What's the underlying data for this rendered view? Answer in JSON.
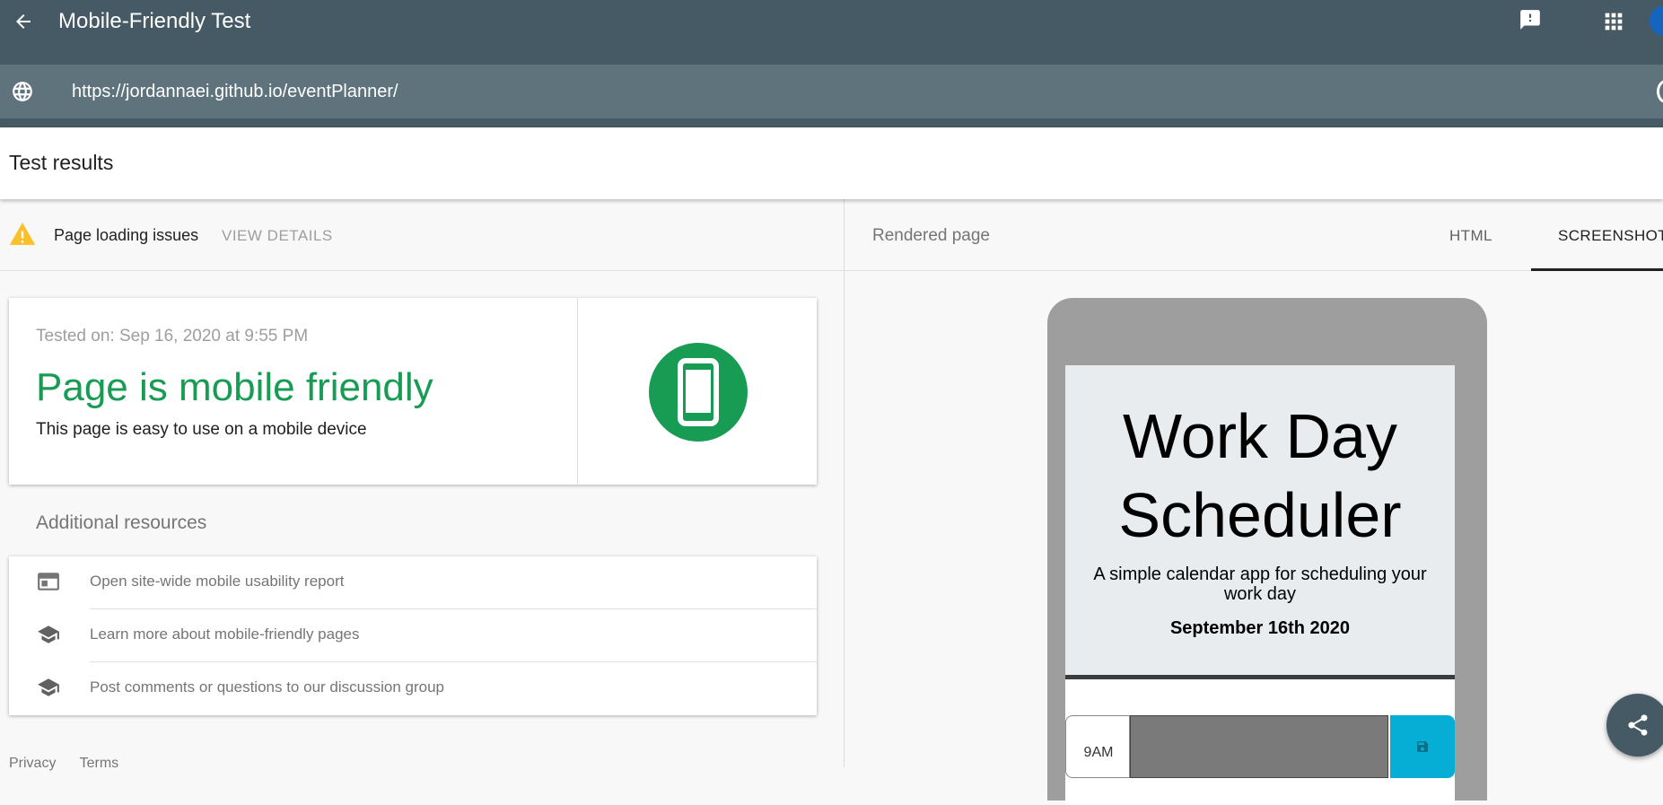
{
  "header": {
    "app_title": "Mobile-Friendly Test",
    "url_value": "https://jordannaei.github.io/eventPlanner/"
  },
  "results": {
    "title": "Test results",
    "issues_text": "Page loading issues",
    "view_details": "VIEW DETAILS"
  },
  "summary_card": {
    "tested_on": "Tested on: Sep 16, 2020 at 9:55 PM",
    "verdict": "Page is mobile friendly",
    "description": "This page is easy to use on a mobile device"
  },
  "resources": {
    "heading": "Additional resources",
    "items": [
      {
        "label": "Open site-wide mobile usability report",
        "icon": "report-icon"
      },
      {
        "label": "Learn more about mobile-friendly pages",
        "icon": "school-icon"
      },
      {
        "label": "Post comments or questions to our discussion group",
        "icon": "school-icon"
      }
    ]
  },
  "footer": {
    "privacy": "Privacy",
    "terms": "Terms"
  },
  "rendered": {
    "label": "Rendered page",
    "tabs": [
      {
        "label": "HTML"
      },
      {
        "label": "SCREENSHOT",
        "selected": true
      }
    ]
  },
  "preview": {
    "title": "Work Day Scheduler",
    "subtitle": "A simple calendar app for scheduling your work day",
    "date": "September 16th 2020",
    "first_hour": "9AM"
  },
  "colors": {
    "topbar": "#455a64",
    "urlbar": "#5f737d",
    "success_green": "#189c54",
    "warning_yellow": "#f9c02a",
    "save_cyan": "#06aed5"
  }
}
